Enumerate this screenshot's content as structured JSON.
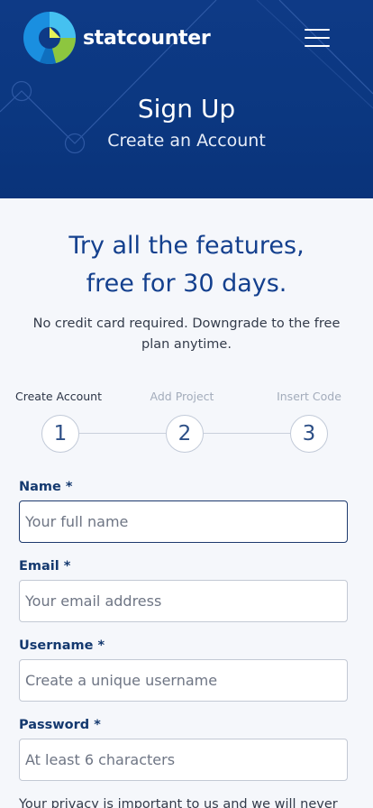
{
  "header": {
    "brand_name": "statcounter",
    "title": "Sign Up",
    "subtitle": "Create an Account",
    "menu_icon": "hamburger-menu-icon",
    "logo_icon": "statcounter-logo-icon",
    "background_color": "#0e3a86"
  },
  "intro": {
    "headline_line1": "Try all the features,",
    "headline_line2": "free for 30 days.",
    "note": "No credit card required. Downgrade to the free plan anytime."
  },
  "steps": [
    {
      "label": "Create Account",
      "number": "1",
      "active": true
    },
    {
      "label": "Add Project",
      "number": "2",
      "active": false
    },
    {
      "label": "Insert Code",
      "number": "3",
      "active": false
    }
  ],
  "form": {
    "name": {
      "label": "Name *",
      "placeholder": "Your full name"
    },
    "email": {
      "label": "Email *",
      "placeholder": "Your email address"
    },
    "username": {
      "label": "Username *",
      "placeholder": "Create a unique username"
    },
    "password": {
      "label": "Password *",
      "placeholder": "At least 6 characters"
    }
  },
  "privacy_text": "Your privacy is important to us and we will never",
  "colors": {
    "accent": "#14408e",
    "label": "#14396f",
    "logo_blue": "#1a8fe0",
    "logo_green": "#8dc63f"
  }
}
